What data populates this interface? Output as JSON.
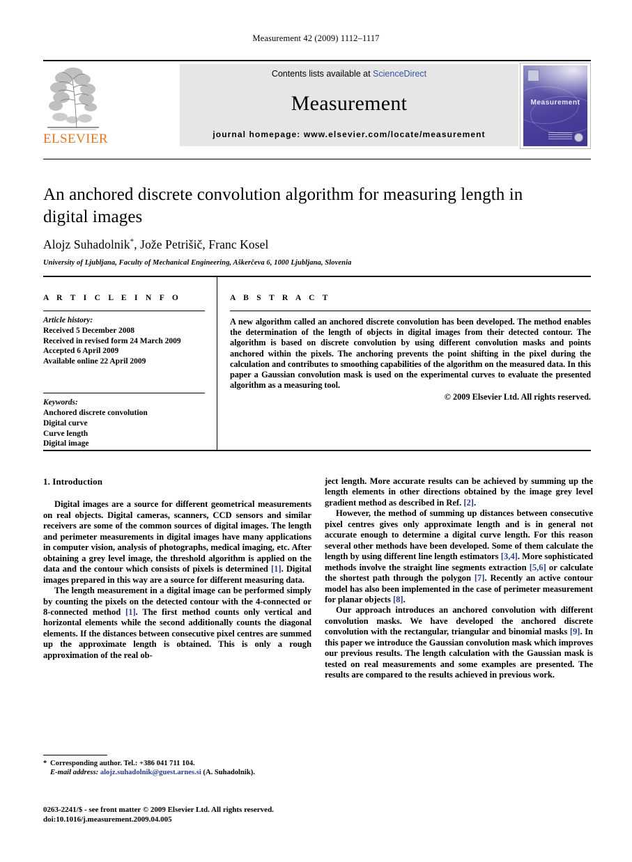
{
  "running_head": "Measurement 42 (2009) 1112–1117",
  "masthead": {
    "publisher_name": "ELSEVIER",
    "contents_prefix": "Contents lists available at ",
    "contents_link": "ScienceDirect",
    "journal_title": "Measurement",
    "homepage": "journal homepage: www.elsevier.com/locate/measurement",
    "cover_title": "Measurement",
    "link_color": "#3a53a4",
    "elsevier_orange": "#E87722"
  },
  "article": {
    "title": "An anchored discrete convolution algorithm for measuring length in digital images",
    "authors": "Alojz Suhadolnik *, Jože Petrišič, Franc Kosel",
    "affiliation": "University of Ljubljana, Faculty of Mechanical Engineering, Aškerčeva 6, 1000 Ljubljana, Slovenia"
  },
  "article_info": {
    "label": "A R T I C L E   I N F O",
    "history_heading": "Article history:",
    "history": [
      "Received 5 December 2008",
      "Received in revised form 24 March 2009",
      "Accepted 6 April 2009",
      "Available online 22 April 2009"
    ],
    "keywords_heading": "Keywords:",
    "keywords": [
      "Anchored discrete convolution",
      "Digital curve",
      "Curve length",
      "Digital image"
    ]
  },
  "abstract": {
    "label": "A B S T R A C T",
    "text": "A new algorithm called an anchored discrete convolution has been developed. The method enables the determination of the length of objects in digital images from their detected contour. The algorithm is based on discrete convolution by using different convolution masks and points anchored within the pixels. The anchoring prevents the point shifting in the pixel during the calculation and contributes to smoothing capabilities of the algorithm on the measured data. In this paper a Gaussian convolution mask is used on the experimental curves to evaluate the presented algorithm as a measuring tool.",
    "copyright": "© 2009 Elsevier Ltd. All rights reserved."
  },
  "body": {
    "section_heading": "1. Introduction",
    "left_paragraphs": [
      "Digital images are a source for different geometrical measurements on real objects. Digital cameras, scanners, CCD sensors and similar receivers are some of the common sources of digital images. The length and perimeter measurements in digital images have many applications in computer vision, analysis of photographs, medical imaging, etc. After obtaining a grey level image, the threshold algorithm is applied on the data and the contour which consists of pixels is determined [1]. Digital images prepared in this way are a source for different measuring data.",
      "The length measurement in a digital image can be performed simply by counting the pixels on the detected contour with the 4-connected or 8-connected method [1]. The first method counts only vertical and horizontal elements while the second additionally counts the diagonal elements. If the distances between consecutive pixel centres are summed up the approximate length is obtained. This is only a rough approximation of the real ob-"
    ],
    "right_paragraphs": [
      "ject length. More accurate results can be achieved by summing up the length elements in other directions obtained by the image grey level gradient method as described in Ref. [2].",
      "However, the method of summing up distances between consecutive pixel centres gives only approximate length and is in general not accurate enough to determine a digital curve length. For this reason several other methods have been developed. Some of them calculate the length by using different line length estimators [3,4]. More sophisticated methods involve the straight line segments extraction [5,6] or calculate the shortest path through the polygon [7]. Recently an active contour model has also been implemented in the case of perimeter measurement for planar objects [8].",
      "Our approach introduces an anchored convolution with different convolution masks. We have developed the anchored discrete convolution with the rectangular, triangular and binomial masks [9]. In this paper we introduce the Gaussian convolution mask which improves our previous results. The length calculation with the Gaussian mask is tested on real measurements and some examples are presented. The results are compared to the results achieved in previous work."
    ]
  },
  "footnote": {
    "marker": "*",
    "corresponding": "Corresponding author. Tel.: +386 041 711 104.",
    "email_label": "E-mail address:",
    "email": "alojz.suhadolnik@guest.arnes.si",
    "email_owner": "(A. Suhadolnik).",
    "link_color": "#2a3d8f"
  },
  "imprint": {
    "issn_line": "0263-2241/$ - see front matter © 2009 Elsevier Ltd. All rights reserved.",
    "doi_line": "doi:10.1016/j.measurement.2009.04.005"
  }
}
